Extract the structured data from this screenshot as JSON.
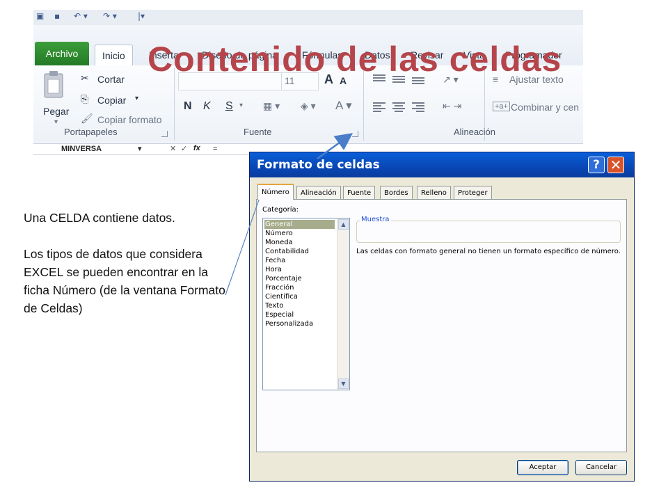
{
  "slide": {
    "title": "Contenido de las celdas",
    "paragraphs": [
      "Una CELDA contiene datos.",
      "Los tipos de datos que considera EXCEL  se pueden encontrar en la ficha Número (de la ventana Formato de Celdas)"
    ]
  },
  "ribbon": {
    "tabs": [
      "Archivo",
      "Inicio",
      "Insertar",
      "Diseño de página",
      "Fórmulas",
      "Datos",
      "Revisar",
      "Vista",
      "Programador"
    ],
    "active_tab": "Inicio",
    "clipboard": {
      "paste": "Pegar",
      "cut": "Cortar",
      "copy": "Copiar",
      "format_painter": "Copiar formato",
      "group": "Portapapeles"
    },
    "font": {
      "size": "11",
      "bold": "N",
      "italic": "K",
      "underline": "S",
      "group": "Fuente"
    },
    "alignment": {
      "wrap": "Ajustar texto",
      "merge": "Combinar y cen",
      "group": "Alineación"
    },
    "name_box": "MINVERSA",
    "fx": "fx",
    "formula": "="
  },
  "dialog": {
    "title": "Formato de celdas",
    "help": "?",
    "tabs": [
      "Número",
      "Alineación",
      "Fuente",
      "Bordes",
      "Relleno",
      "Proteger"
    ],
    "active_tab": "Número",
    "category_label": "Categoría:",
    "categories": [
      "General",
      "Número",
      "Moneda",
      "Contabilidad",
      "Fecha",
      "Hora",
      "Porcentaje",
      "Fracción",
      "Científica",
      "Texto",
      "Especial",
      "Personalizada"
    ],
    "selected_category": "General",
    "sample_label": "Muestra",
    "description": "Las celdas con formato general no tienen un formato específico de número.",
    "ok": "Aceptar",
    "cancel": "Cancelar"
  },
  "colors": {
    "title": "#b5454a",
    "file_tab": "#2f8a30",
    "dialog_titlebar": "#0a52c6",
    "arrow": "#4a7ec9"
  }
}
